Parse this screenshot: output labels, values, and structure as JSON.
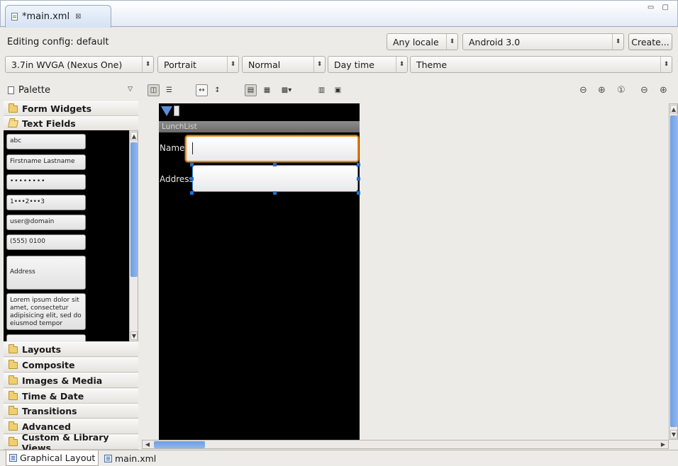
{
  "editor_tab": {
    "title": "*main.xml",
    "close_glyph": "⊠"
  },
  "window_controls": "▭ ▢",
  "config": {
    "editing_label": "Editing config: default",
    "locale": "Any locale",
    "target": "Android 3.0",
    "create_button": "Create...",
    "device": "3.7in WVGA (Nexus One)",
    "orientation": "Portrait",
    "density": "Normal",
    "daytime": "Day time",
    "theme": "Theme"
  },
  "palette": {
    "title": "Palette",
    "categories_top": [
      "Form Widgets",
      "Text Fields"
    ],
    "text_field_items": [
      "abc",
      "Firstname Lastname",
      "••••••••",
      "1•••2•••3",
      "user@domain",
      "(555) 0100",
      "Address",
      "Lorem ipsum dolor sit amet, consectetur adipisicing elit, sed do eiusmod tempor"
    ],
    "categories_bottom": [
      "Layouts",
      "Composite",
      "Images & Media",
      "Time & Date",
      "Transitions",
      "Advanced",
      "Custom & Library Views"
    ]
  },
  "device_preview": {
    "app_title": "LunchList",
    "name_label": "Name:",
    "address_label": "Address:"
  },
  "bottom_tabs": {
    "graphical": "Graphical Layout",
    "xml": "main.xml"
  },
  "colors": {
    "accent_blue": "#1b6fd6",
    "focus_orange": "#f08a12"
  }
}
